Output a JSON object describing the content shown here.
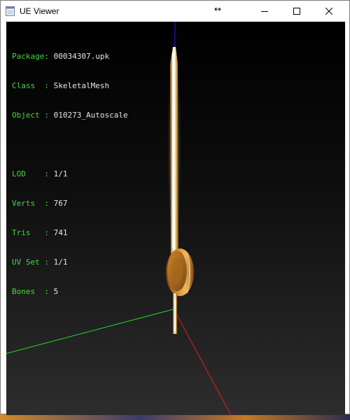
{
  "window": {
    "title": "UE Viewer"
  },
  "icons": {
    "app": "ue-viewer-app-icon",
    "minimize": "minimize-icon",
    "maximize": "maximize-icon",
    "close": "close-icon",
    "cursor": "horizontal-resize-cursor"
  },
  "cursor_glyph": "↔",
  "info": {
    "package": {
      "key": "Package:",
      "value": "00034307.upk"
    },
    "class": {
      "key": "Class  :",
      "value": "SkeletalMesh"
    },
    "object": {
      "key": "Object :",
      "value": "010273_Autoscale"
    },
    "lod": {
      "key": "LOD    :",
      "value": "1/1"
    },
    "verts": {
      "key": "Verts  :",
      "value": "767"
    },
    "tris": {
      "key": "Tris   :",
      "value": "741"
    },
    "uvset": {
      "key": "UV Set :",
      "value": "1/1"
    },
    "bones": {
      "key": "Bones  :",
      "value": "5"
    }
  },
  "colors": {
    "info_key": "#45d83e",
    "info_value": "#e6e6e6",
    "axis_x": "#e02020",
    "axis_y": "#22dd22",
    "axis_z": "#2020ff"
  }
}
